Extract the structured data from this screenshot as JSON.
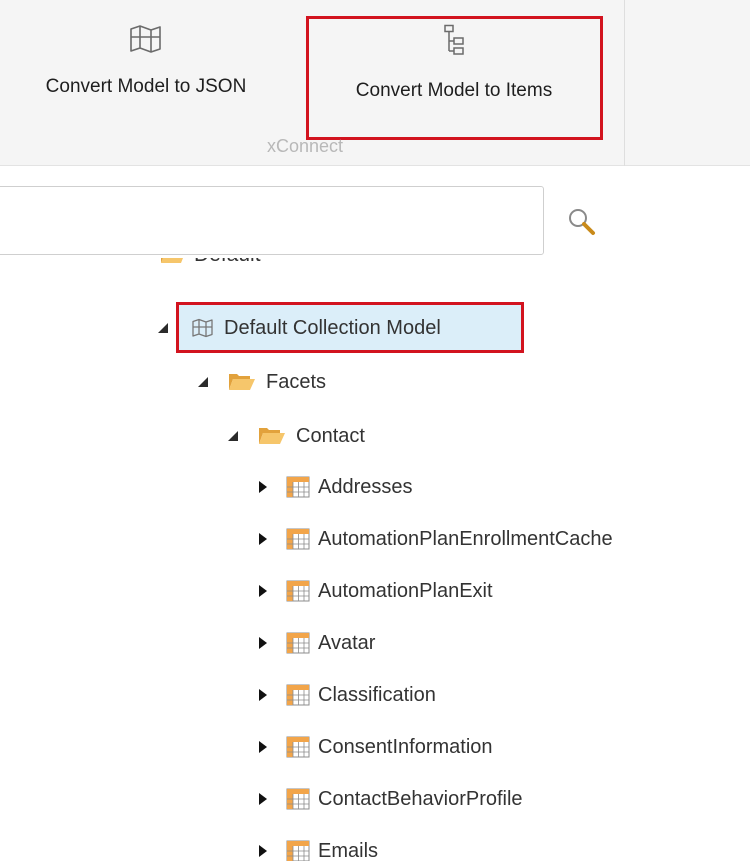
{
  "ribbon": {
    "buttons": [
      {
        "label": "Convert Model to JSON",
        "icon": "map-icon"
      },
      {
        "label": "Convert Model to Items",
        "icon": "hierarchy-icon"
      }
    ],
    "group_label": "xConnect"
  },
  "search": {
    "value": "",
    "placeholder": "",
    "icon": "search-icon"
  },
  "tree": {
    "partial_label": "Default",
    "root": {
      "label": "Default Collection Model",
      "icon": "map-icon",
      "expanded": true,
      "selected": true
    },
    "facets": {
      "label": "Facets",
      "icon": "open-folder-icon",
      "expanded": true
    },
    "contact": {
      "label": "Contact",
      "icon": "open-folder-icon",
      "expanded": true
    },
    "items": [
      {
        "label": "Addresses",
        "icon": "table-icon"
      },
      {
        "label": "AutomationPlanEnrollmentCache",
        "icon": "table-icon"
      },
      {
        "label": "AutomationPlanExit",
        "icon": "table-icon"
      },
      {
        "label": "Avatar",
        "icon": "table-icon"
      },
      {
        "label": "Classification",
        "icon": "table-icon"
      },
      {
        "label": "ConsentInformation",
        "icon": "table-icon"
      },
      {
        "label": "ContactBehaviorProfile",
        "icon": "table-icon"
      },
      {
        "label": "Emails",
        "icon": "table-icon"
      }
    ]
  },
  "colors": {
    "highlight_border": "#d2131f",
    "selected_bg": "#dbeef9",
    "folder": "#f1b24a",
    "ribbon_bg": "#f5f5f5"
  }
}
